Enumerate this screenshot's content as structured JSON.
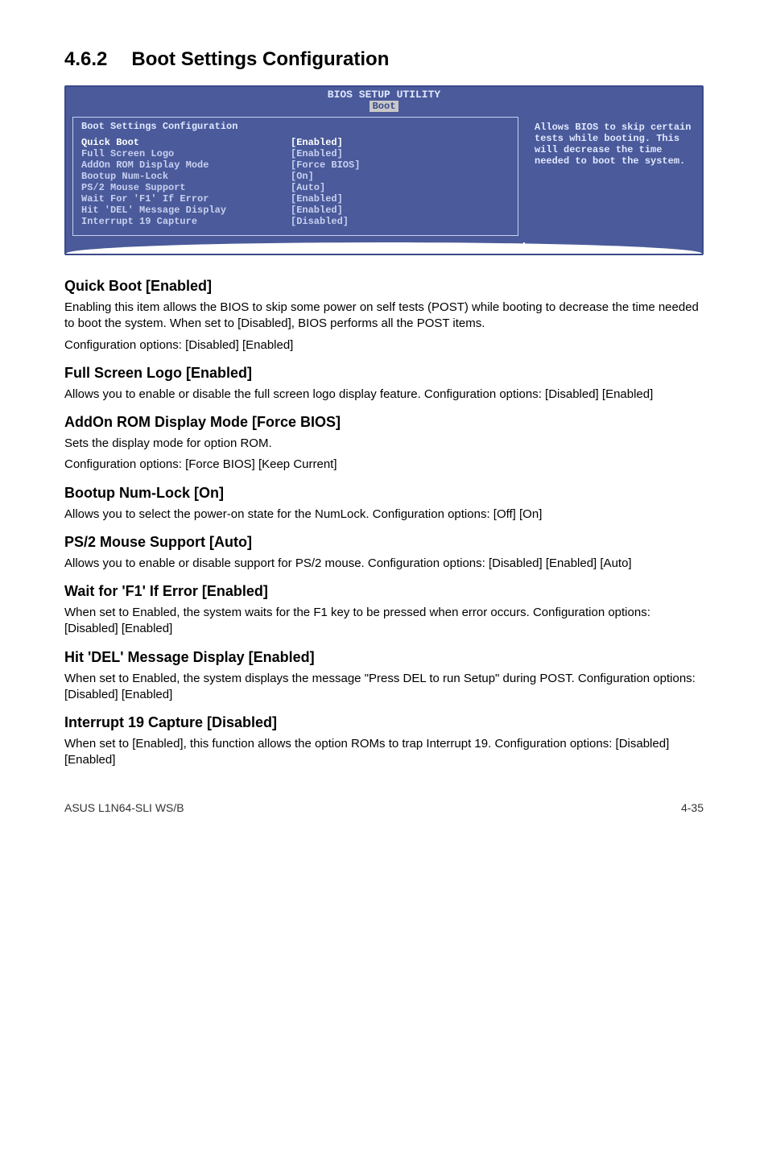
{
  "section": {
    "number": "4.6.2",
    "title": "Boot Settings Configuration"
  },
  "bios": {
    "headerTop": "BIOS SETUP UTILITY",
    "tab": "Boot",
    "panelTitle": "Boot Settings Configuration",
    "rows": [
      {
        "label": "Quick Boot",
        "value": "[Enabled]"
      },
      {
        "label": "Full Screen Logo",
        "value": "[Enabled]"
      },
      {
        "label": "AddOn ROM Display Mode",
        "value": "[Force BIOS]"
      },
      {
        "label": "Bootup Num-Lock",
        "value": "[On]"
      },
      {
        "label": "PS/2 Mouse Support",
        "value": "[Auto]"
      },
      {
        "label": "Wait For 'F1' If Error",
        "value": "[Enabled]"
      },
      {
        "label": "Hit 'DEL' Message Display",
        "value": "[Enabled]"
      },
      {
        "label": "Interrupt 19 Capture",
        "value": "[Disabled]"
      }
    ],
    "help": "Allows BIOS to skip certain tests while booting.  This will decrease the time needed to boot the system."
  },
  "items": [
    {
      "heading": "Quick Boot [Enabled]",
      "paras": [
        "Enabling this item allows the BIOS to skip some power on self tests (POST) while booting to decrease the time needed to boot the system. When set to [Disabled], BIOS performs all the POST items.",
        "Configuration options: [Disabled] [Enabled]"
      ]
    },
    {
      "heading": "Full Screen Logo [Enabled]",
      "paras": [
        "Allows you to enable or disable the full screen logo display feature. Configuration options: [Disabled] [Enabled]"
      ]
    },
    {
      "heading": "AddOn ROM Display Mode [Force BIOS]",
      "paras": [
        "Sets the display mode for option ROM.",
        "Configuration options: [Force BIOS] [Keep Current]"
      ]
    },
    {
      "heading": "Bootup Num-Lock [On]",
      "paras": [
        "Allows you to select the power-on state for the NumLock. Configuration options: [Off] [On]"
      ]
    },
    {
      "heading": "PS/2 Mouse Support [Auto]",
      "paras": [
        "Allows you to enable or disable support for PS/2 mouse. Configuration options: [Disabled] [Enabled] [Auto]"
      ]
    },
    {
      "heading": "Wait for 'F1' If Error [Enabled]",
      "paras": [
        "When set to Enabled, the system waits for the F1 key to be pressed when error occurs. Configuration options: [Disabled] [Enabled]"
      ]
    },
    {
      "heading": "Hit 'DEL' Message Display [Enabled]",
      "paras": [
        "When set to Enabled, the system displays the message \"Press DEL to run Setup\" during POST. Configuration options: [Disabled] [Enabled]"
      ]
    },
    {
      "heading": "Interrupt 19 Capture [Disabled]",
      "paras": [
        "When set to [Enabled], this function allows the option ROMs to trap Interrupt 19. Configuration options: [Disabled] [Enabled]"
      ]
    }
  ],
  "footer": {
    "left": "ASUS L1N64-SLI WS/B",
    "right": "4-35"
  }
}
